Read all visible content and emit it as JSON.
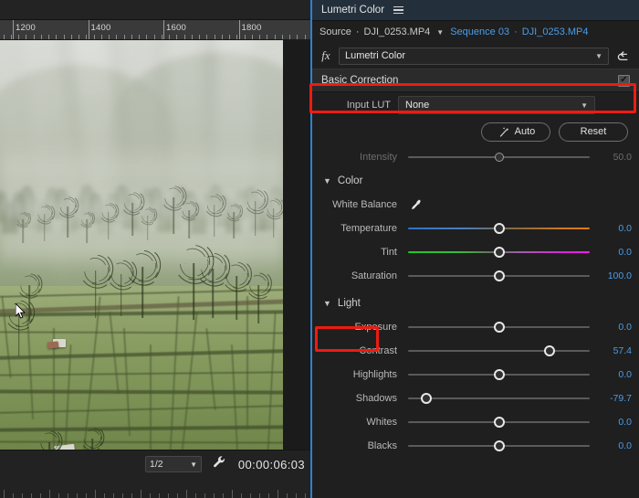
{
  "monitor": {
    "ruler": {
      "labels": [
        "1200",
        "1400",
        "1600",
        "1800"
      ]
    },
    "preview": {
      "alt": "aerial drone footage of misty rice terraces with palm trees"
    },
    "toolbar": {
      "fit_value": "1/2",
      "fit_chevron": "chevron-down-icon",
      "settings_icon": "wrench-icon",
      "timecode": "00:00:06:03"
    }
  },
  "panel": {
    "tab_label": "Lumetri Color",
    "menu_icon": "hamburger-menu-icon",
    "source": {
      "source_label": "Source",
      "separator": "·",
      "source_clip": "DJI_0253.MP4",
      "chevron": "chevron-down-icon",
      "sequence_label": "Sequence 03",
      "sequence_clip": "DJI_0253.MP4"
    },
    "fx": {
      "icon": "fx",
      "effect_name": "Lumetri Color",
      "chevron": "chevron-down-icon",
      "reset_icon": "reset-arrow-icon"
    },
    "basic_correction": {
      "title": "Basic Correction",
      "enabled": true,
      "checkmark": "✔"
    },
    "input_lut": {
      "label": "Input LUT",
      "value": "None",
      "chevron": "chevron-down-icon"
    },
    "buttons": {
      "auto_label": "Auto",
      "auto_icon": "magic-wand-icon",
      "reset_label": "Reset"
    },
    "intensity": {
      "label": "Intensity",
      "value": "50.0",
      "percent": 50,
      "disabled": true
    },
    "color_group": {
      "label": "Color",
      "expanded": true,
      "triangle": "chevron-down-icon"
    },
    "color_sliders": [
      {
        "label": "White Balance",
        "type": "eyedropper",
        "icon": "eyedropper-icon"
      },
      {
        "label": "Temperature",
        "value": "0.0",
        "percent": 50,
        "gradient": "temp"
      },
      {
        "label": "Tint",
        "value": "0.0",
        "percent": 50,
        "gradient": "tint"
      },
      {
        "label": "Saturation",
        "value": "100.0",
        "percent": 50,
        "gradient": "plain"
      }
    ],
    "light_group": {
      "label": "Light",
      "expanded": true,
      "triangle": "chevron-down-icon"
    },
    "light_sliders": [
      {
        "label": "Exposure",
        "value": "0.0",
        "percent": 50
      },
      {
        "label": "Contrast",
        "value": "57.4",
        "percent": 78
      },
      {
        "label": "Highlights",
        "value": "0.0",
        "percent": 50
      },
      {
        "label": "Shadows",
        "value": "-79.7",
        "percent": 10
      },
      {
        "label": "Whites",
        "value": "0.0",
        "percent": 50
      },
      {
        "label": "Blacks",
        "value": "0.0",
        "percent": 50
      }
    ]
  },
  "annotations": {
    "accent_red": "#ee1b11",
    "accent_blue": "#4a9de8",
    "panel_border": "#2f7fd0",
    "callouts": [
      {
        "name": "basic-correction-callout"
      },
      {
        "name": "light-group-callout"
      }
    ]
  }
}
